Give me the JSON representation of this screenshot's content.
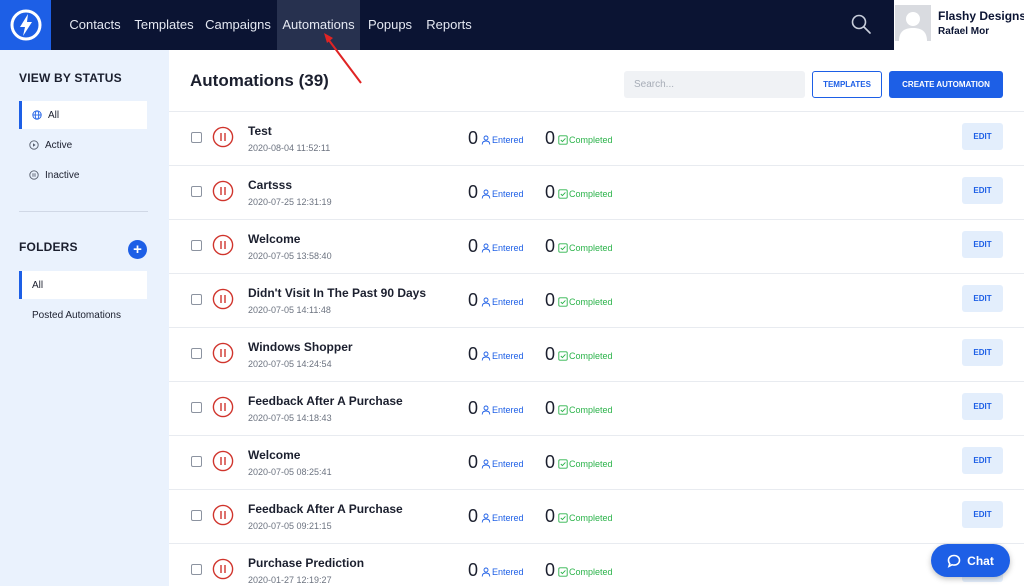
{
  "nav": {
    "items": [
      {
        "label": "Contacts"
      },
      {
        "label": "Templates"
      },
      {
        "label": "Campaigns"
      },
      {
        "label": "Automations"
      },
      {
        "label": "Popups"
      },
      {
        "label": "Reports"
      }
    ],
    "active": "Automations",
    "user": {
      "name": "Flashy Designs",
      "sub": "Rafael Mor"
    }
  },
  "sidebar": {
    "status_title": "VIEW BY STATUS",
    "status_items": [
      {
        "label": "All",
        "icon": "globe-icon",
        "selected": true
      },
      {
        "label": "Active",
        "icon": "play-icon",
        "selected": false
      },
      {
        "label": "Inactive",
        "icon": "pause-icon",
        "selected": false
      }
    ],
    "folders_title": "FOLDERS",
    "folder_items": [
      {
        "label": "All",
        "selected": true
      },
      {
        "label": "Posted Automations",
        "selected": false
      }
    ]
  },
  "main": {
    "title": "Automations (39)",
    "search_placeholder": "Search...",
    "templates_button": "TEMPLATES",
    "create_button": "CREATE AUTOMATION",
    "entered_label": "Entered",
    "completed_label": "Completed",
    "edit_label": "EDIT",
    "rows": [
      {
        "name": "Test",
        "date": "2020-08-04 11:52:11",
        "entered": "0",
        "completed": "0"
      },
      {
        "name": "Cartsss",
        "date": "2020-07-25 12:31:19",
        "entered": "0",
        "completed": "0"
      },
      {
        "name": "Welcome",
        "date": "2020-07-05 13:58:40",
        "entered": "0",
        "completed": "0"
      },
      {
        "name": "Didn't Visit In The Past 90 Days",
        "date": "2020-07-05 14:11:48",
        "entered": "0",
        "completed": "0"
      },
      {
        "name": "Windows Shopper",
        "date": "2020-07-05 14:24:54",
        "entered": "0",
        "completed": "0"
      },
      {
        "name": "Feedback After A Purchase",
        "date": "2020-07-05 14:18:43",
        "entered": "0",
        "completed": "0"
      },
      {
        "name": "Welcome",
        "date": "2020-07-05 08:25:41",
        "entered": "0",
        "completed": "0"
      },
      {
        "name": "Feedback After A Purchase",
        "date": "2020-07-05 09:21:15",
        "entered": "0",
        "completed": "0"
      },
      {
        "name": "Purchase Prediction",
        "date": "2020-01-27 12:19:27",
        "entered": "0",
        "completed": "0"
      }
    ]
  },
  "chat": {
    "label": "Chat"
  },
  "colors": {
    "nav_bg": "#0b1433",
    "accent": "#1d5fe6",
    "sidebar_bg": "#eaf2fd",
    "paused_red": "#d0342c",
    "completed_green": "#2bb34a",
    "annotation_red": "#e02424"
  }
}
